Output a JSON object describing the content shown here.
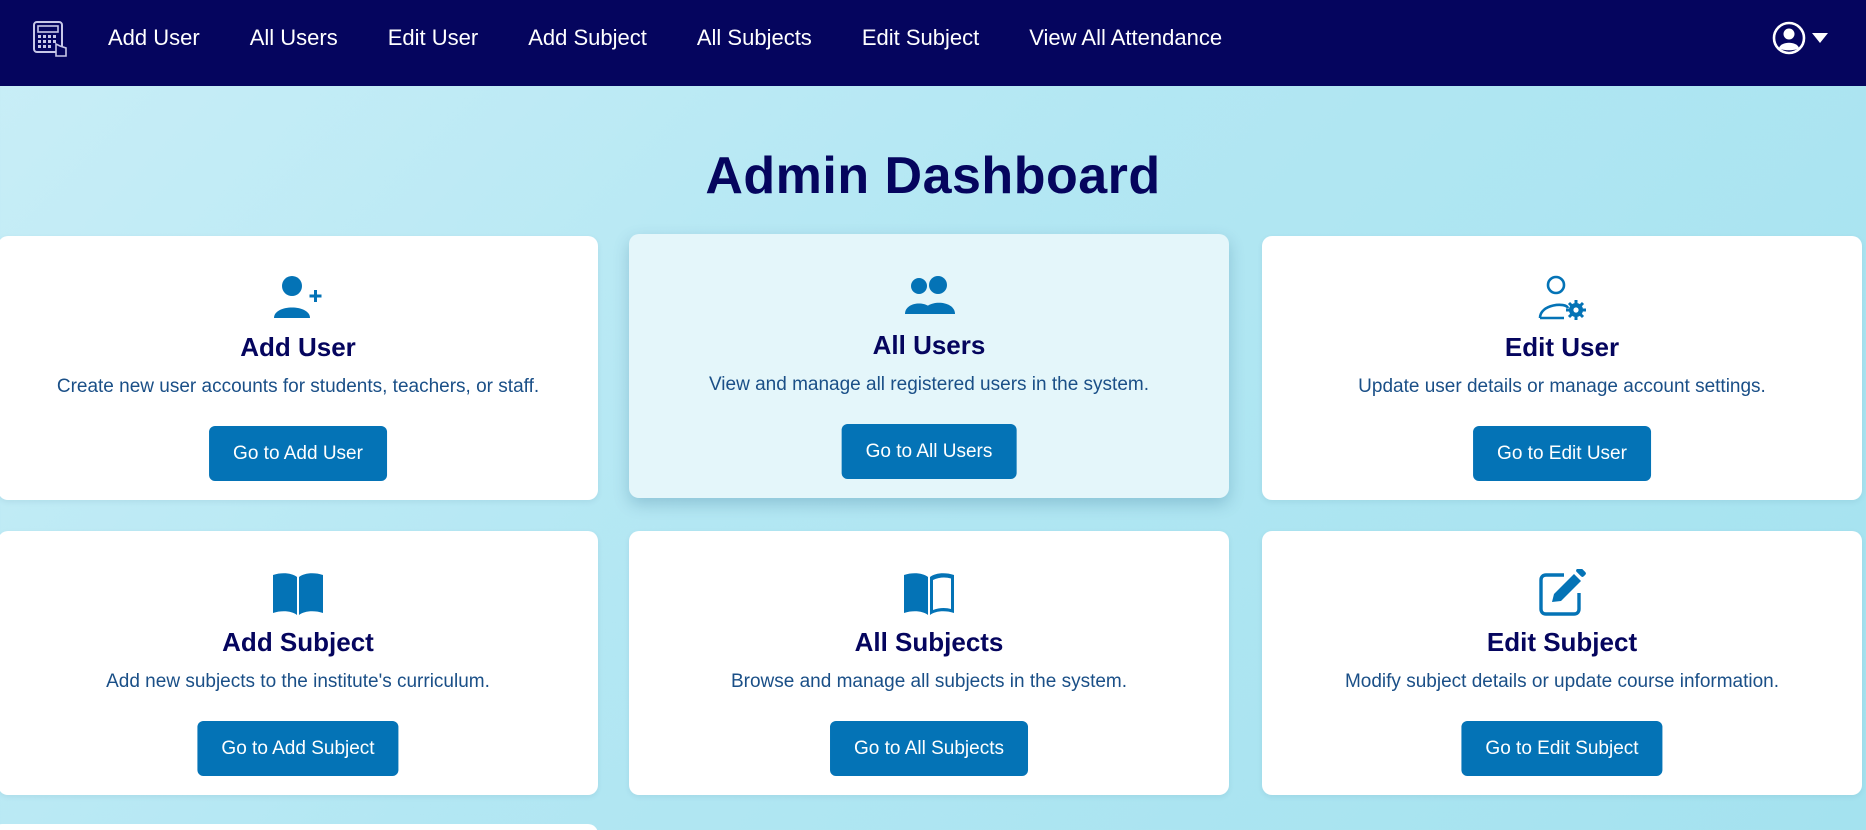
{
  "nav": {
    "brand_icon": "calculator-hand-icon",
    "links": [
      "Add User",
      "All Users",
      "Edit User",
      "Add Subject",
      "All Subjects",
      "Edit Subject",
      "View All Attendance"
    ],
    "user_icon": "user-circle-icon",
    "caret_icon": "caret-down-icon"
  },
  "page": {
    "title": "Admin Dashboard"
  },
  "cards": [
    {
      "icon": "user-plus-icon",
      "title": "Add User",
      "description": "Create new user accounts for students, teachers, or staff.",
      "button": "Go to Add User"
    },
    {
      "icon": "users-icon",
      "title": "All Users",
      "description": "View and manage all registered users in the system.",
      "button": "Go to All Users"
    },
    {
      "icon": "user-gear-icon",
      "title": "Edit User",
      "description": "Update user details or manage account settings.",
      "button": "Go to Edit User"
    },
    {
      "icon": "book-open-solid-icon",
      "title": "Add Subject",
      "description": "Add new subjects to the institute's curriculum.",
      "button": "Go to Add Subject"
    },
    {
      "icon": "book-open-outline-icon",
      "title": "All Subjects",
      "description": "Browse and manage all subjects in the system.",
      "button": "Go to All Subjects"
    },
    {
      "icon": "pen-to-square-icon",
      "title": "Edit Subject",
      "description": "Modify subject details or update course information.",
      "button": "Go to Edit Subject"
    }
  ],
  "colors": {
    "navbar": "#05055e",
    "accent": "#0473b6",
    "heading": "#05055e",
    "description": "#1a4f87",
    "background": "#b3e7f3"
  }
}
